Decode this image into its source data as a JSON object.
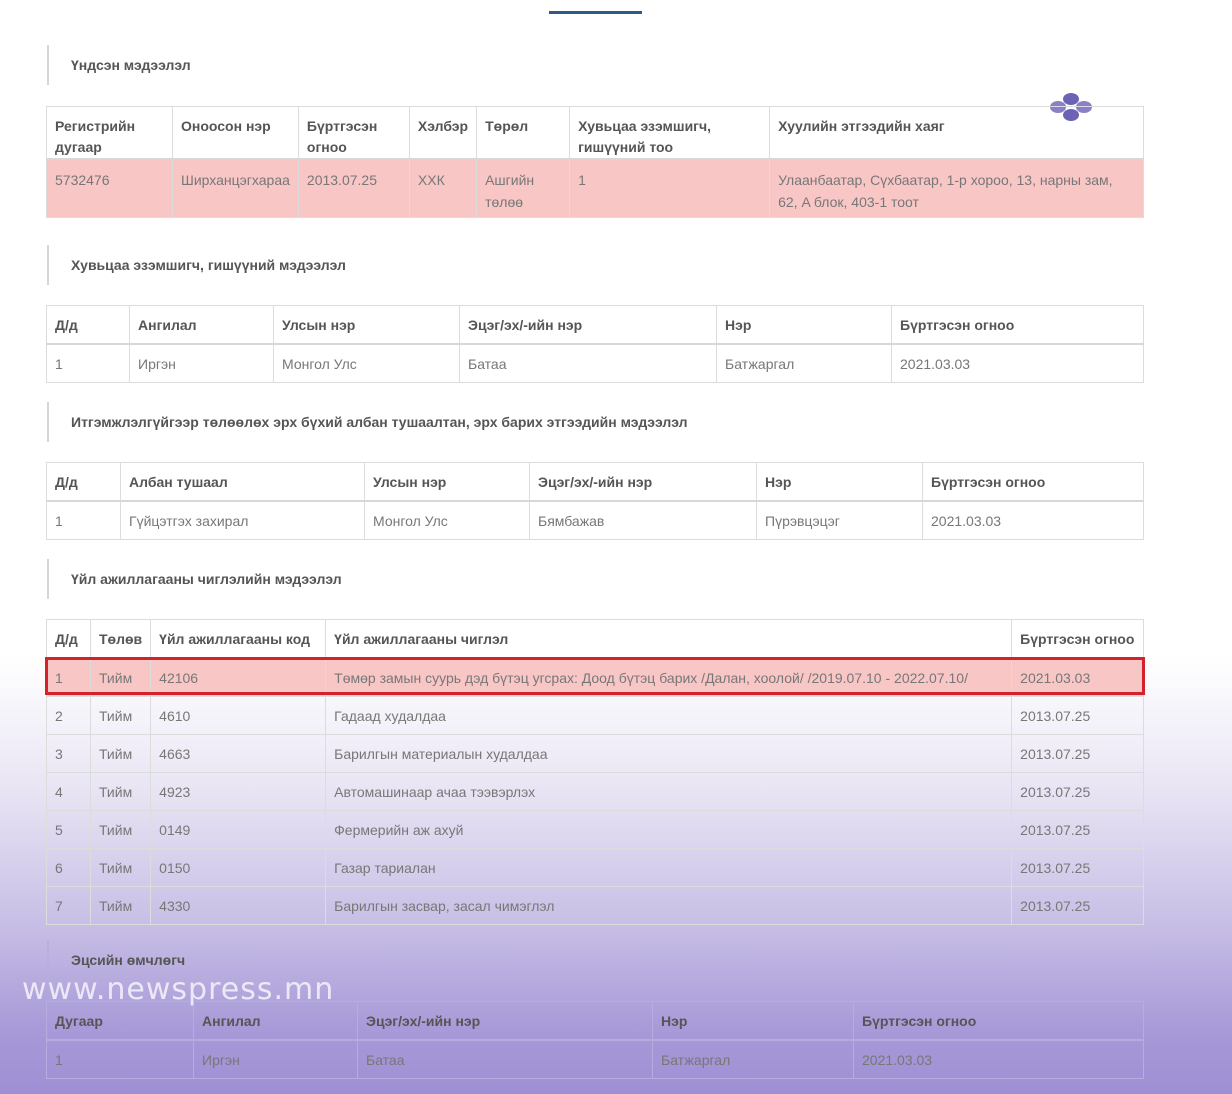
{
  "sections": {
    "basic": "Үндсэн мэдээлэл",
    "shareholders": "Хувьцаа эзэмшигч, гишүүний мэдээлэл",
    "officials": "Итгэмжлэлгүйгээр төлөөлөх эрх бүхий албан тушаалтан, эрх барих этгээдийн мэдээлэл",
    "activities": "Үйл ажиллагааны чиглэлийн мэдээлэл",
    "owner": "Эцсийн өмчлөгч"
  },
  "basic": {
    "headers": [
      "Регистрийн дугаар",
      "Оноосон нэр",
      "Бүртгэсэн огноо",
      "Хэлбэр",
      "Төрөл",
      "Хувьцаа эзэмшигч, гишүүний тоо",
      "Хуулийн этгээдийн хаяг"
    ],
    "row": [
      "5732476",
      "Ширханцэгхараа",
      "2013.07.25",
      "ХХК",
      "Ашгийн төлөө",
      "1",
      "Улаанбаатар, Сүхбаатар, 1-р хороо, 13, нарны зам, 62, A блок, 403-1 тоот"
    ]
  },
  "shareholders": {
    "headers": [
      "Д/д",
      "Ангилал",
      "Улсын нэр",
      "Эцэг/эх/-ийн нэр",
      "Нэр",
      "Бүртгэсэн огноо"
    ],
    "rows": [
      [
        "1",
        "Иргэн",
        "Монгол Улс",
        "Батаа",
        "Батжаргал",
        "2021.03.03"
      ]
    ]
  },
  "officials": {
    "headers": [
      "Д/д",
      "Албан тушаал",
      "Улсын нэр",
      "Эцэг/эх/-ийн нэр",
      "Нэр",
      "Бүртгэсэн огноо"
    ],
    "rows": [
      [
        "1",
        "Гүйцэтгэх захирал",
        "Монгол Улс",
        "Бямбажав",
        "Пүрэвцэцэг",
        "2021.03.03"
      ]
    ]
  },
  "activities": {
    "headers": [
      "Д/д",
      "Төлөв",
      "Үйл ажиллагааны код",
      "Үйл ажиллагааны чиглэл",
      "Бүртгэсэн огноо"
    ],
    "rows": [
      [
        "1",
        "Тийм",
        "42106",
        "Төмөр замын суурь дэд бүтэц угсрах: Доод бүтэц барих /Далан, хоолой/ /2019.07.10 - 2022.07.10/",
        "2021.03.03"
      ],
      [
        "2",
        "Тийм",
        "4610",
        "Гадаад худалдаа",
        "2013.07.25"
      ],
      [
        "3",
        "Тийм",
        "4663",
        "Барилгын материалын худалдаа",
        "2013.07.25"
      ],
      [
        "4",
        "Тийм",
        "4923",
        "Автомашинаар ачаа тээвэрлэх",
        "2013.07.25"
      ],
      [
        "5",
        "Тийм",
        "0149",
        "Фермерийн аж ахуй",
        "2013.07.25"
      ],
      [
        "6",
        "Тийм",
        "0150",
        "Газар тариалан",
        "2013.07.25"
      ],
      [
        "7",
        "Тийм",
        "4330",
        "Барилгын засвар, засал чимэглэл",
        "2013.07.25"
      ]
    ]
  },
  "owner": {
    "headers": [
      "Дугаар",
      "Ангилал",
      "Эцэг/эх/-ийн нэр",
      "Нэр",
      "Бүртгэсэн огноо"
    ],
    "rows": [
      [
        "1",
        "Иргэн",
        "Батаа",
        "Батжаргал",
        "2021.03.03"
      ]
    ]
  },
  "watermark": "www.newspress.mn",
  "colors": {
    "highlight_row": "#f9c6c6",
    "highlight_border": "#d4222a",
    "accent": "#2f5a87"
  }
}
